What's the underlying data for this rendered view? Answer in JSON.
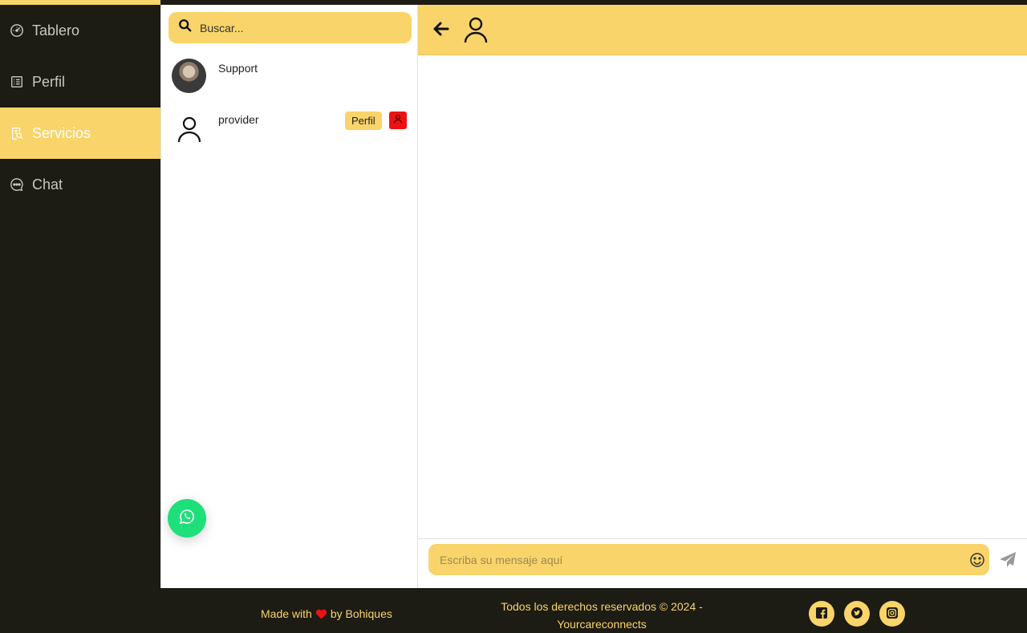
{
  "colors": {
    "accent": "#f9d46a",
    "dark": "#1c1b14",
    "danger": "#ee1111",
    "whatsapp": "#1ee07a"
  },
  "sidebar": {
    "items": [
      {
        "label": "Tablero",
        "icon": "dashboard-icon",
        "active": false
      },
      {
        "label": "Perfil",
        "icon": "list-icon",
        "active": false
      },
      {
        "label": "Servicios",
        "icon": "services-icon",
        "active": true
      },
      {
        "label": "Chat",
        "icon": "chat-bubble-icon",
        "active": false
      }
    ]
  },
  "contacts": {
    "search_placeholder": "Buscar...",
    "list": [
      {
        "name": "Support",
        "avatar": "photo"
      },
      {
        "name": "provider",
        "avatar": "user-icon",
        "profile_button": "Perfil",
        "block_icon": "user-block-icon"
      }
    ]
  },
  "chat": {
    "message_placeholder": "Escriba su mensaje aquí"
  },
  "footer": {
    "made_with_prefix": "Made with",
    "made_with_suffix": "by Bohiques",
    "copyright_line1": "Todos los derechos reservados © 2024 -",
    "copyright_line2": "Yourcareconnects",
    "socials": [
      "facebook-icon",
      "twitter-icon",
      "instagram-icon"
    ]
  }
}
